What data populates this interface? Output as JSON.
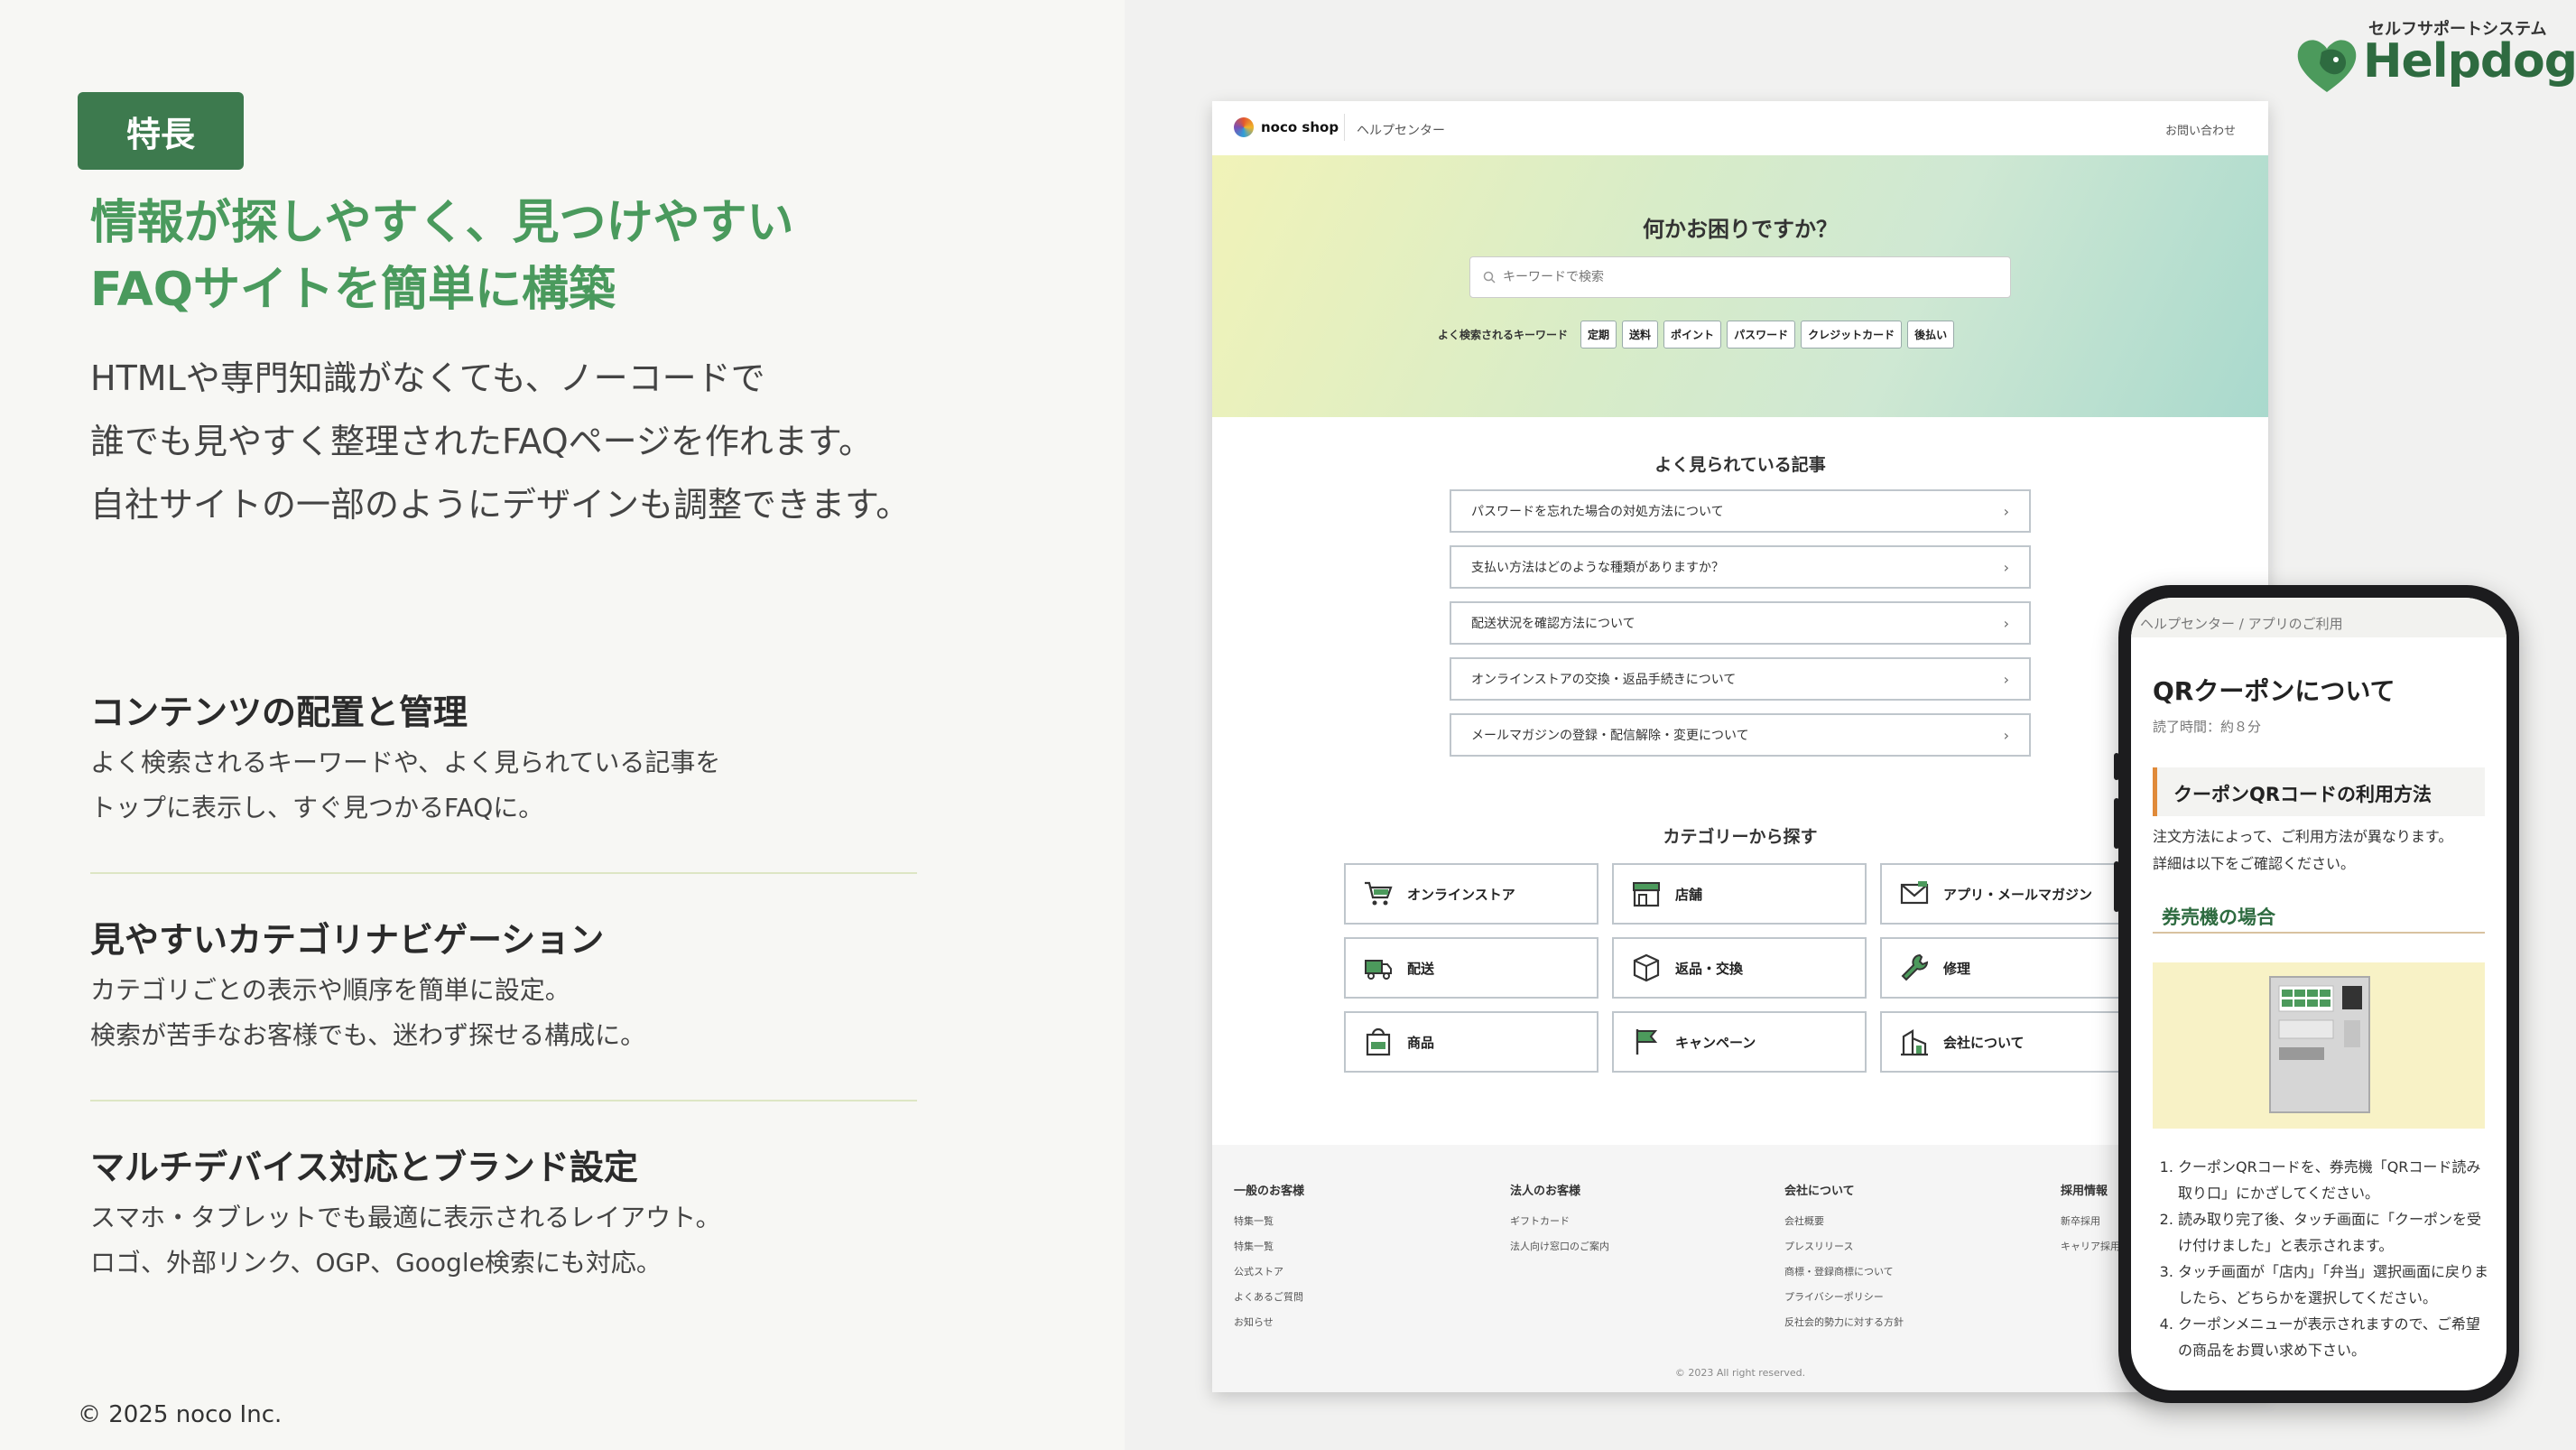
{
  "badge": "特長",
  "headline": [
    "情報が探しやすく、見つけやすい",
    "FAQサイトを簡単に構築"
  ],
  "lead": [
    "HTMLや専門知識がなくても、ノーコードで",
    "誰でも見やすく整理されたFAQページを作れます。",
    "自社サイトの一部のようにデザインも調整できます。"
  ],
  "sections": [
    {
      "title": "コンテンツの配置と管理",
      "lines": [
        "よく検索されるキーワードや、よく見られている記事を",
        "トップに表示し、すぐ見つかるFAQに。"
      ]
    },
    {
      "title": "見やすいカテゴリナビゲーション",
      "lines": [
        "カテゴリごとの表示や順序を簡単に設定。",
        "検索が苦手なお客様でも、迷わず探せる構成に。"
      ]
    },
    {
      "title": "マルチデバイス対応とブランド設定",
      "lines": [
        "スマホ・タブレットでも最適に表示されるレイアウト。",
        "ロゴ、外部リンク、OGP、Google検索にも対応。"
      ]
    }
  ],
  "copyright": "© 2025 noco Inc.",
  "logo": {
    "tagline": "セルフサポートシステム",
    "name": "Helpdog",
    "color": "#2e6b40"
  },
  "desktop": {
    "brand": "noco shop",
    "help_center": "ヘルプセンター",
    "contact": "お問い合わせ",
    "hero_title": "何かお困りですか？",
    "search_placeholder": "キーワードで検索",
    "keywords_label": "よく検索されるキーワード",
    "keywords": [
      "定期",
      "送料",
      "ポイント",
      "パスワード",
      "クレジットカード",
      "後払い"
    ],
    "popular_title": "よく見られている記事",
    "popular": [
      "パスワードを忘れた場合の対処方法について",
      "支払い方法はどのような種類がありますか？",
      "配送状況を確認方法について",
      "オンラインストアの交換・返品手続きについて",
      "メールマガジンの登録・配信解除・変更について"
    ],
    "category_title": "カテゴリーから探す",
    "categories": [
      {
        "label": "オンラインストア",
        "icon": "cart-icon"
      },
      {
        "label": "店舗",
        "icon": "store-icon"
      },
      {
        "label": "アプリ・メールマガジン",
        "icon": "mail-icon"
      },
      {
        "label": "配送",
        "icon": "truck-icon"
      },
      {
        "label": "返品・交換",
        "icon": "box-icon"
      },
      {
        "label": "修理",
        "icon": "wrench-icon"
      },
      {
        "label": "商品",
        "icon": "bag-icon"
      },
      {
        "label": "キャンペーン",
        "icon": "flag-icon"
      },
      {
        "label": "会社について",
        "icon": "building-icon"
      }
    ],
    "footer": [
      {
        "head": "一般のお客様",
        "links": [
          "特集一覧",
          "特集一覧",
          "公式ストア",
          "よくあるご質問",
          "お知らせ"
        ]
      },
      {
        "head": "法人のお客様",
        "links": [
          "ギフトカード",
          "法人向け窓口のご案内"
        ]
      },
      {
        "head": "会社について",
        "links": [
          "会社概要",
          "プレスリリース",
          "商標・登録商標について",
          "プライバシーポリシー",
          "反社会的勢力に対する方針"
        ]
      },
      {
        "head": "採用情報",
        "links": [
          "新卒採用",
          "キャリア採用"
        ]
      }
    ],
    "footer_copy": "© 2023 All right reserved."
  },
  "phone": {
    "breadcrumb": "ヘルプセンター / アプリのご利用",
    "title": "QRクーポンについて",
    "read_time": "読了時間：約８分",
    "h2": "クーポンQRコードの利用方法",
    "intro": [
      "注文方法によって、ご利用方法が異なります。",
      "詳細は以下をご確認ください。"
    ],
    "h3": "券売機の場合",
    "steps": [
      "クーポンQRコードを、券売機「QRコード読み取り口」にかざしてください。",
      "読み取り完了後、タッチ画面に「クーポンを受け付けました」と表示されます。",
      "タッチ画面が「店内」「弁当」選択画面に戻りましたら、どちらかを選択してください。",
      "クーポンメニューが表示されますので、ご希望の商品をお買い求め下さい。"
    ]
  }
}
